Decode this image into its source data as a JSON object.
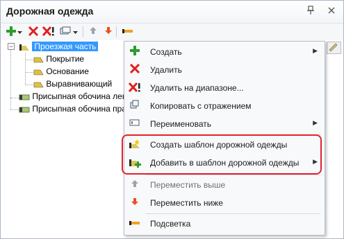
{
  "window": {
    "title": "Дорожная одежда",
    "pin_icon": "pin-icon",
    "close_icon": "close-icon"
  },
  "tree": {
    "items": [
      {
        "label": "Проезжая часть",
        "level": 0,
        "selected": true
      },
      {
        "label": "Покрытие",
        "level": 1
      },
      {
        "label": "Основание",
        "level": 1
      },
      {
        "label": "Выравнивающий",
        "level": 1
      },
      {
        "label": "Присыпная обочина лев.",
        "level": 0
      },
      {
        "label": "Присыпная обочина прав.",
        "level": 0
      }
    ]
  },
  "menu": {
    "items": [
      {
        "label": "Создать",
        "icon": "plus-icon",
        "submenu": true
      },
      {
        "label": "Удалить",
        "icon": "delete-icon"
      },
      {
        "label": "Удалить на диапазоне...",
        "icon": "delete-range-icon"
      },
      {
        "label": "Копировать с отражением",
        "icon": "copy-mirror-icon"
      },
      {
        "label": "Переименовать",
        "icon": "rename-icon",
        "submenu": true
      },
      {
        "label": "Создать шаблон дорожной одежды",
        "icon": "template-create-icon"
      },
      {
        "label": "Добавить в шаблон дорожной одежды",
        "icon": "template-add-icon",
        "submenu": true
      },
      {
        "label": "Переместить выше",
        "icon": "arrow-up-icon",
        "disabled": true
      },
      {
        "label": "Переместить ниже",
        "icon": "arrow-down-icon"
      },
      {
        "label": "Подсветка",
        "icon": "highlight-icon"
      }
    ]
  },
  "colors": {
    "accent_green": "#2e9b2e",
    "delete_red": "#e02020",
    "selection": "#3399ff",
    "callout_red": "#e3212f"
  }
}
